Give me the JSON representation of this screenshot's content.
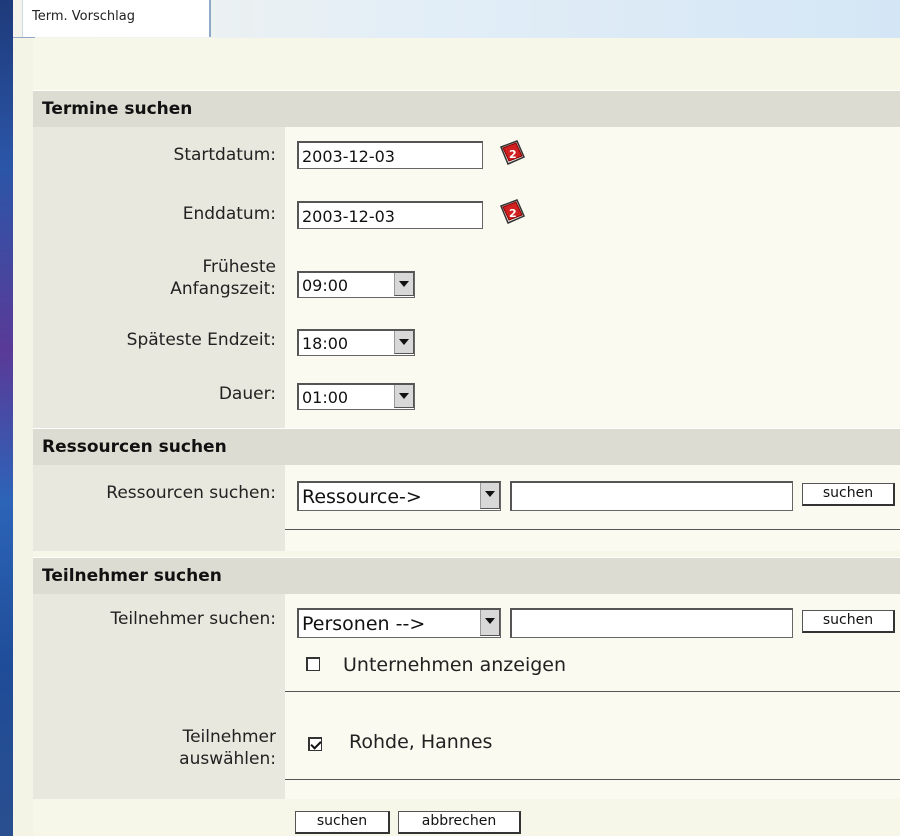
{
  "tab": {
    "label": "Term. Vorschlag"
  },
  "termine": {
    "heading": "Termine suchen",
    "start_label": "Startdatum:",
    "start_value": "2003-12-03",
    "end_label": "Enddatum:",
    "end_value": "2003-12-03",
    "earliest_label_1": "Früheste",
    "earliest_label_2": "Anfangszeit:",
    "earliest_value": "09:00",
    "latest_label": "Späteste Endzeit:",
    "latest_value": "18:00",
    "duration_label": "Dauer:",
    "duration_value": "01:00",
    "calendar_icon_text": "2"
  },
  "ressourcen": {
    "heading": "Ressourcen suchen",
    "label": "Ressourcen suchen:",
    "select_value": "Ressource->",
    "search_value": "",
    "button": "suchen"
  },
  "teilnehmer": {
    "heading": "Teilnehmer suchen",
    "label": "Teilnehmer suchen:",
    "select_value": "Personen -->",
    "search_value": "",
    "button": "suchen",
    "checkbox_label": "Unternehmen anzeigen",
    "checkbox_checked": false,
    "select_label_1": "Teilnehmer",
    "select_label_2": "auswählen:",
    "participant": "Rohde, Hannes",
    "participant_checked": true
  },
  "footer": {
    "search_button": "suchen",
    "cancel_button": "abbrechen"
  },
  "colors": {
    "section_header": "#dcdcd2",
    "label_column": "#e8e8de",
    "field_background": "#fafaf0",
    "calendar_red": "#d02020"
  },
  "icons": {
    "calendar": "calendar-icon",
    "dropdown": "chevron-down-icon",
    "checkbox": "checkbox"
  }
}
